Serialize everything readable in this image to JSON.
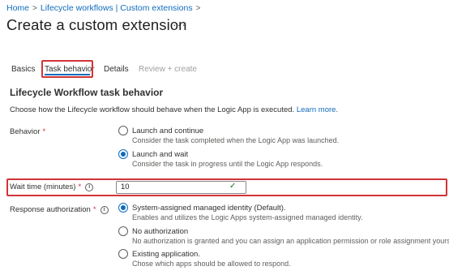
{
  "breadcrumb": {
    "home": "Home",
    "lifecycle": "Lifecycle workflows | Custom extensions",
    "separator": ">"
  },
  "page": {
    "title": "Create a custom extension",
    "more": "···"
  },
  "tabs": [
    {
      "label": "Basics"
    },
    {
      "label": "Task behavior"
    },
    {
      "label": "Details"
    },
    {
      "label": "Review + create"
    }
  ],
  "section": {
    "title": "Lifecycle Workflow task behavior",
    "description": "Choose how the Lifecycle workflow should behave when the Logic App is executed.",
    "learn_more": "Learn more."
  },
  "behavior": {
    "label": "Behavior",
    "required": "*",
    "options": [
      {
        "label": "Launch and continue",
        "description": "Consider the task completed when the Logic App was launched."
      },
      {
        "label": "Launch and wait",
        "description": "Consider the task in progress until the Logic App responds."
      }
    ],
    "selected": "Launch and wait"
  },
  "wait_time": {
    "label": "Wait time (minutes)",
    "required": "*",
    "value": "10"
  },
  "response_authorization": {
    "label": "Response authorization",
    "required": "*",
    "options": [
      {
        "label": "System-assigned managed identity (Default).",
        "description": "Enables and utilizes the Logic Apps system-assigned managed identity."
      },
      {
        "label": "No authorization",
        "description": "No authorization is granted and you can assign an application permission or role assignment yourself."
      },
      {
        "label": "Existing application.",
        "description": "Chose which apps should be allowed to respond."
      }
    ],
    "selected": "System-assigned managed identity (Default)."
  },
  "colors": {
    "accent": "#0f6cbd",
    "highlight": "#d13438",
    "valid": "#107c10"
  },
  "icons": {
    "info": "info-icon",
    "check": "checkmark-icon"
  }
}
